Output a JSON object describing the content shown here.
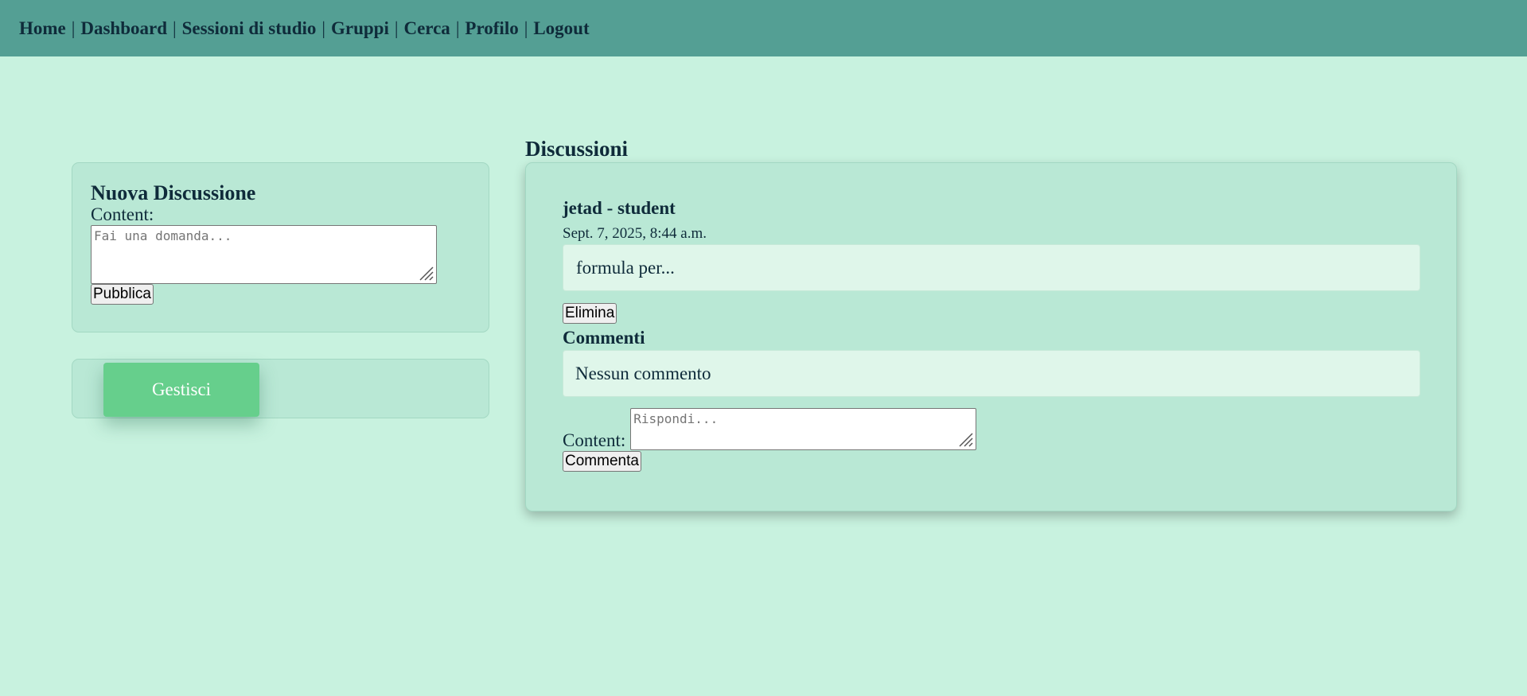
{
  "nav": {
    "items": [
      "Home",
      "Dashboard",
      "Sessioni di studio",
      "Gruppi",
      "Cerca",
      "Profilo",
      "Logout"
    ],
    "separator": "|"
  },
  "new_discussion": {
    "title": "Nuova Discussione",
    "content_label": "Content:",
    "placeholder": "Fai una domanda...",
    "submit_label": "Pubblica"
  },
  "manage": {
    "button_label": "Gestisci"
  },
  "discussions": {
    "section_title": "Discussioni",
    "post": {
      "author": "jetad - student",
      "timestamp": "Sept. 7, 2025, 8:44 a.m.",
      "content": "formula per...",
      "delete_label": "Elimina",
      "comments_title": "Commenti",
      "no_comments": "Nessun commento",
      "comment_label": "Content:",
      "comment_placeholder": "Rispondi...",
      "comment_submit": "Commenta"
    }
  },
  "colors": {
    "page_bg": "#c8f2df",
    "navbar_bg": "#549f94",
    "panel_bg": "#b9e8d5",
    "content_bg": "#dff6ea",
    "manage_button": "#66cf8c",
    "text": "#0f2b3a"
  }
}
